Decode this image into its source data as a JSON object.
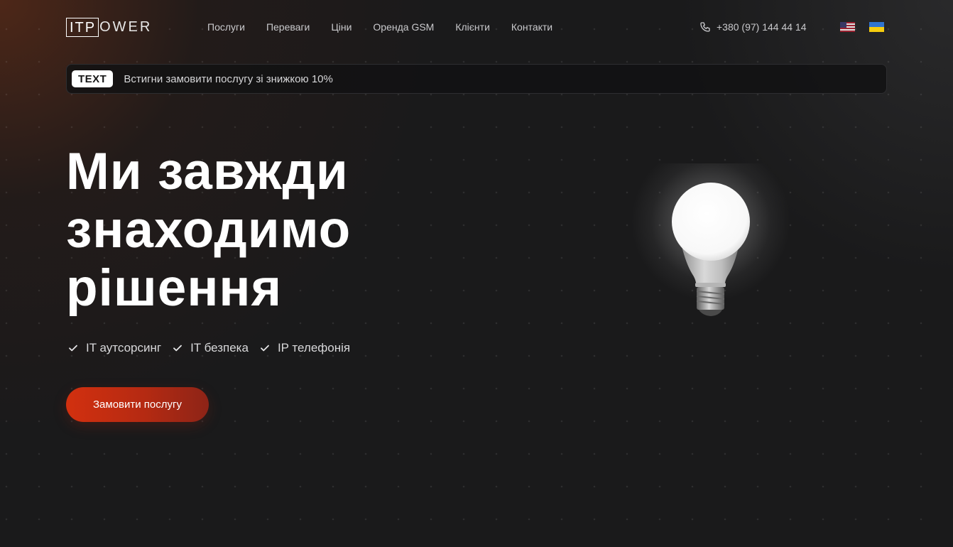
{
  "header": {
    "logo_box": "ITP",
    "logo_rest": "OWER",
    "nav": [
      {
        "label": "Послуги"
      },
      {
        "label": "Переваги"
      },
      {
        "label": "Ціни"
      },
      {
        "label": "Оренда GSM"
      },
      {
        "label": "Клієнти"
      },
      {
        "label": "Контакти"
      }
    ],
    "phone": "+380 (97) 144 44 14",
    "phone_icon": "phone-icon",
    "languages": [
      {
        "flag": "us-flag-icon"
      },
      {
        "flag": "ua-flag-icon"
      }
    ]
  },
  "promo": {
    "badge": "TEXT",
    "text": "Встигни замовити послугу зі знижкою 10%"
  },
  "hero": {
    "title_lines": [
      "Ми завжди",
      "знаходимо",
      "рішення"
    ],
    "features": [
      {
        "label": "IT аутсорсинг",
        "icon": "check-icon"
      },
      {
        "label": "IT безпека",
        "icon": "check-icon"
      },
      {
        "label": "IP телефонія",
        "icon": "check-icon"
      }
    ],
    "cta_label": "Замовити послугу",
    "image": "light-bulb-illustration"
  },
  "colors": {
    "background": "#1a1a1b",
    "accent": "#d2300f",
    "accent_dark": "#8d2417",
    "text": "#ffffff",
    "muted_text": "#c9c9cc"
  }
}
